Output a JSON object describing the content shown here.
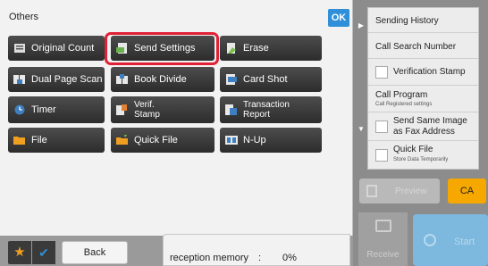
{
  "panel": {
    "title": "Others",
    "ok_label": "OK"
  },
  "functions": [
    {
      "label": "Original Count",
      "icon": "original-count-icon"
    },
    {
      "label": "Send Settings",
      "icon": "send-settings-icon"
    },
    {
      "label": "Erase",
      "icon": "erase-icon"
    },
    {
      "label": "Dual Page Scan",
      "icon": "dual-page-scan-icon"
    },
    {
      "label": "Book Divide",
      "icon": "book-divide-icon"
    },
    {
      "label": "Card Shot",
      "icon": "card-shot-icon"
    },
    {
      "label": "Timer",
      "icon": "timer-icon"
    },
    {
      "label": "Verif.\nStamp",
      "icon": "verif-stamp-icon"
    },
    {
      "label": "Transaction\nReport",
      "icon": "transaction-report-icon"
    },
    {
      "label": "File",
      "icon": "folder-icon"
    },
    {
      "label": "Quick File",
      "icon": "quick-file-icon"
    },
    {
      "label": "N-Up",
      "icon": "n-up-icon"
    }
  ],
  "bottom": {
    "back_label": "Back",
    "memory_label": "reception memory",
    "memory_colon": ":",
    "memory_value": "0%"
  },
  "right_panel": {
    "items": [
      {
        "label": "Sending History"
      },
      {
        "label": "Call Search Number"
      },
      {
        "label": "Verification Stamp"
      },
      {
        "label": "Call Program",
        "sub": "Call Registered settings"
      },
      {
        "label": "Send Same Image\nas Fax Address"
      },
      {
        "label": "Quick File",
        "sub": "Store Data Temporarily"
      }
    ],
    "preview_label": "Preview",
    "ca_label": "CA",
    "receive_label": "Receive",
    "start_label": "Start"
  },
  "colors": {
    "highlight": "#e02035",
    "ok": "#2f8fd8",
    "ca": "#f6a800",
    "start": "#7db8de"
  }
}
